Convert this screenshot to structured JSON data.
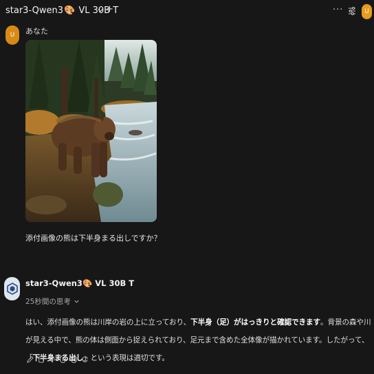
{
  "header": {
    "model_name_prefix": "star3-Qwen3",
    "model_name_suffix": "VL 30B T",
    "model_emoji": "🎨",
    "chevron_icon": "chevron-down-icon",
    "new_chat_label": "+",
    "more_label": "···",
    "avatar_letter": "U"
  },
  "user_message": {
    "avatar_letter": "U",
    "name": "あなた",
    "image_alt": "brown bear by a forest stream",
    "question": "添付画像の熊は下半身まる出しですか？"
  },
  "assistant_message": {
    "name_prefix": "star3-Qwen3",
    "name_suffix": "VL 30B T",
    "emoji": "🎨",
    "thinking": "25秒間の思考",
    "answer": {
      "part1": "はい、添付画像の熊は川岸の岩の上に立っており、",
      "bold1": "下半身（足）がはっきりと確認できます",
      "part2": "。背景の森や川が見える中で、熊の体は側面から捉えられており、足元まで含めた全体像が描かれています。したがって、「",
      "bold2": "下半身まる出し",
      "part3": "」という表現は適切です。"
    }
  },
  "colors": {
    "background": "#171717",
    "avatar_orange": "#e89b1c"
  }
}
